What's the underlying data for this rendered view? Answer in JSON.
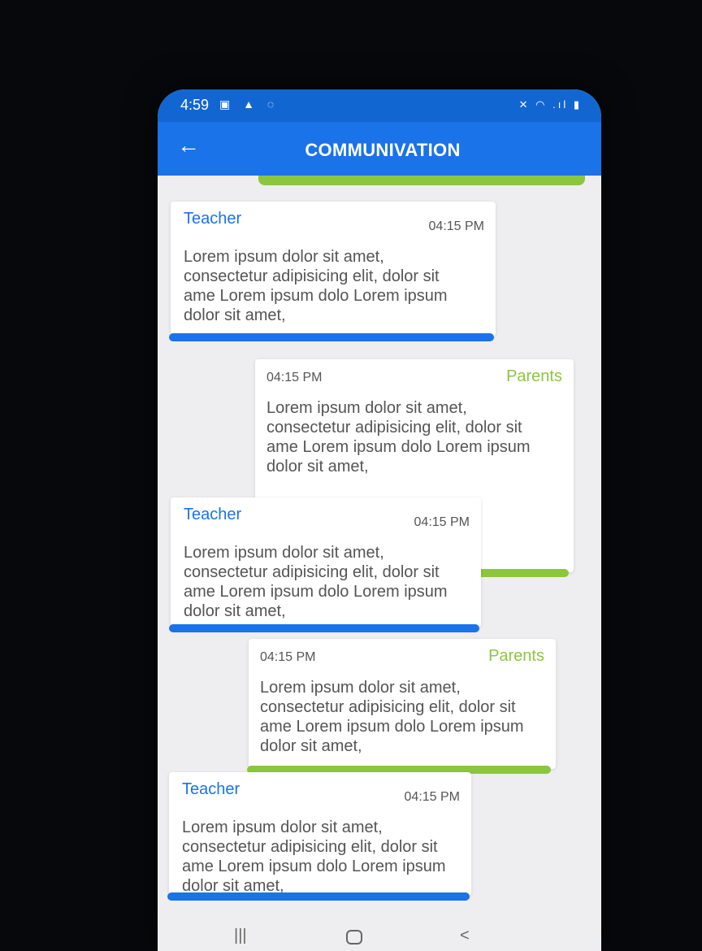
{
  "status_bar": {
    "time": "4:59",
    "left_icons": "▣ ▲ ◌",
    "right_icons": "✕ ◠ .ıl ▮"
  },
  "app_bar": {
    "back_icon": "←",
    "title": "COMMUNIVATION"
  },
  "messages": [
    {
      "sender": "Teacher",
      "time": "04:15 PM",
      "text": "Lorem ipsum dolor sit amet,\nconsectetur adipisicing elit, dolor sit\name Lorem ipsum dolo Lorem ipsum\ndolor sit amet,"
    },
    {
      "sender": "Parents",
      "time": "04:15 PM",
      "text": "Lorem ipsum dolor sit amet,\nconsectetur adipisicing elit, dolor sit\name Lorem ipsum dolo Lorem ipsum\ndolor sit amet,"
    },
    {
      "sender": "Teacher",
      "time": "04:15 PM",
      "text": "Lorem ipsum dolor sit amet,\nconsectetur adipisicing elit, dolor sit\name Lorem ipsum dolo Lorem ipsum\ndolor sit amet,"
    },
    {
      "sender": "Parents",
      "time": "04:15 PM",
      "text": "Lorem ipsum dolor sit amet,\nconsectetur adipisicing elit, dolor sit\name Lorem ipsum dolo Lorem ipsum\ndolor sit amet,"
    },
    {
      "sender": "Teacher",
      "time": "04:15 PM",
      "text": "Lorem ipsum dolor sit amet,\nconsectetur adipisicing elit, dolor sit\name Lorem ipsum dolo Lorem ipsum\ndolor sit amet,"
    }
  ],
  "nav_bar": {
    "recent_icon": "|||",
    "back_icon": "<"
  },
  "colors": {
    "primary_blue": "#1a73e8",
    "accent_green": "#8cc63f"
  }
}
